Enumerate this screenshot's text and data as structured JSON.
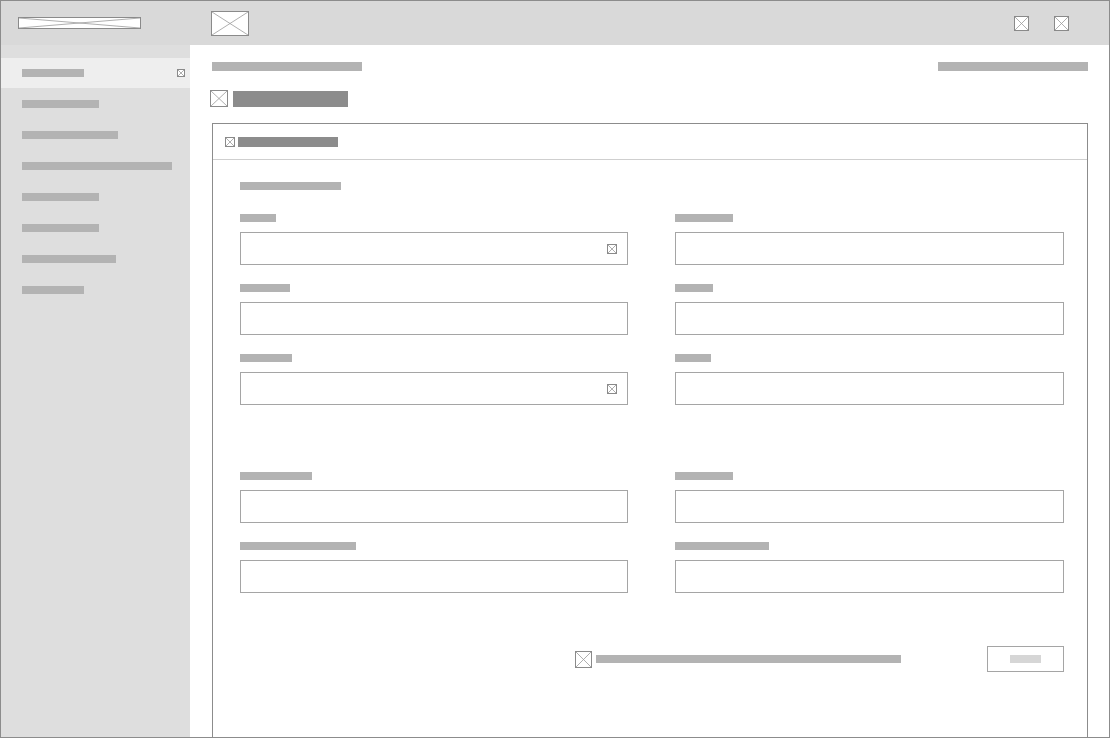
{
  "sidebar": {
    "items": [
      {
        "selected": true
      },
      {
        "selected": false
      },
      {
        "selected": false
      },
      {
        "selected": false
      },
      {
        "selected": false
      },
      {
        "selected": false
      },
      {
        "selected": false
      },
      {
        "selected": false
      }
    ]
  },
  "form": {
    "groups": [
      {
        "fields": [
          {
            "kind": "select"
          },
          {
            "kind": "text"
          },
          {
            "kind": "text"
          },
          {
            "kind": "text"
          },
          {
            "kind": "select"
          },
          {
            "kind": "text"
          }
        ]
      },
      {
        "fields": [
          {
            "kind": "text"
          },
          {
            "kind": "text"
          },
          {
            "kind": "text"
          },
          {
            "kind": "text"
          }
        ]
      }
    ]
  },
  "footer": {
    "checkbox": {
      "checked": false
    }
  }
}
